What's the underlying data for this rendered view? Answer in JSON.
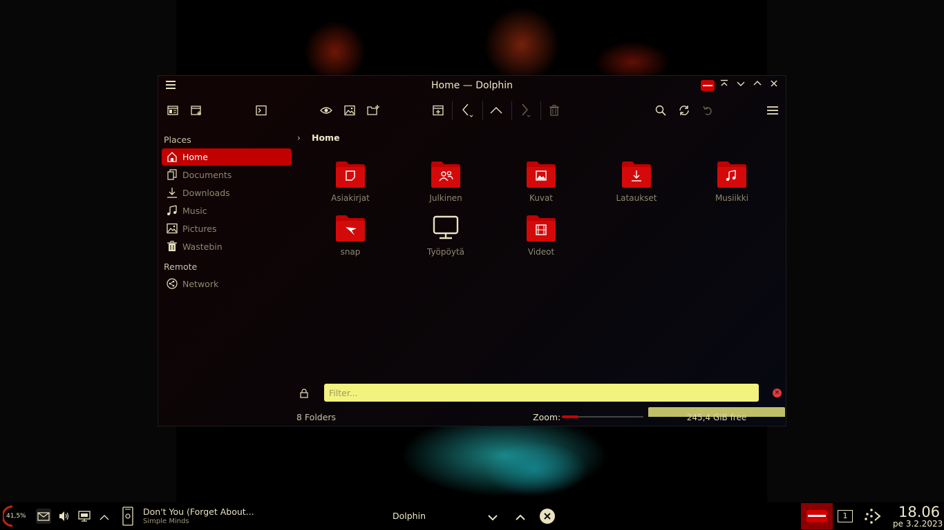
{
  "window": {
    "title": "Home — Dolphin"
  },
  "sidebar": {
    "places_heading": "Places",
    "remote_heading": "Remote",
    "items": [
      {
        "label": "Home"
      },
      {
        "label": "Documents"
      },
      {
        "label": "Downloads"
      },
      {
        "label": "Music"
      },
      {
        "label": "Pictures"
      },
      {
        "label": "Wastebin"
      },
      {
        "label": "Network"
      }
    ]
  },
  "breadcrumb": {
    "current": "Home"
  },
  "folders": [
    {
      "label": "Asiakirjat",
      "icon": "document-folder-icon"
    },
    {
      "label": "Julkinen",
      "icon": "public-folder-icon"
    },
    {
      "label": "Kuvat",
      "icon": "pictures-folder-icon"
    },
    {
      "label": "Lataukset",
      "icon": "downloads-folder-icon"
    },
    {
      "label": "Musiikki",
      "icon": "music-folder-icon"
    },
    {
      "label": "snap",
      "icon": "snap-folder-icon"
    },
    {
      "label": "Työpöytä",
      "icon": "desktop-monitor-icon"
    },
    {
      "label": "Videot",
      "icon": "videos-folder-icon"
    }
  ],
  "filter": {
    "placeholder": "Filter..."
  },
  "status": {
    "count": "8 Folders",
    "zoom_label": "Zoom:",
    "zoom_level": 0.2,
    "free_space": "245,4 GiB free"
  },
  "panel": {
    "battery": "41,5%",
    "media_title": "Don't You (Forget About...",
    "media_artist": "Simple Minds",
    "task": "Dolphin",
    "pager": "1",
    "time": "18.06",
    "date": "pe 3.2.2023"
  },
  "colors": {
    "accent": "#c20000",
    "filter_bg": "#f2f27e",
    "text": "#e9e2c0",
    "dim_text": "#8e8870"
  }
}
